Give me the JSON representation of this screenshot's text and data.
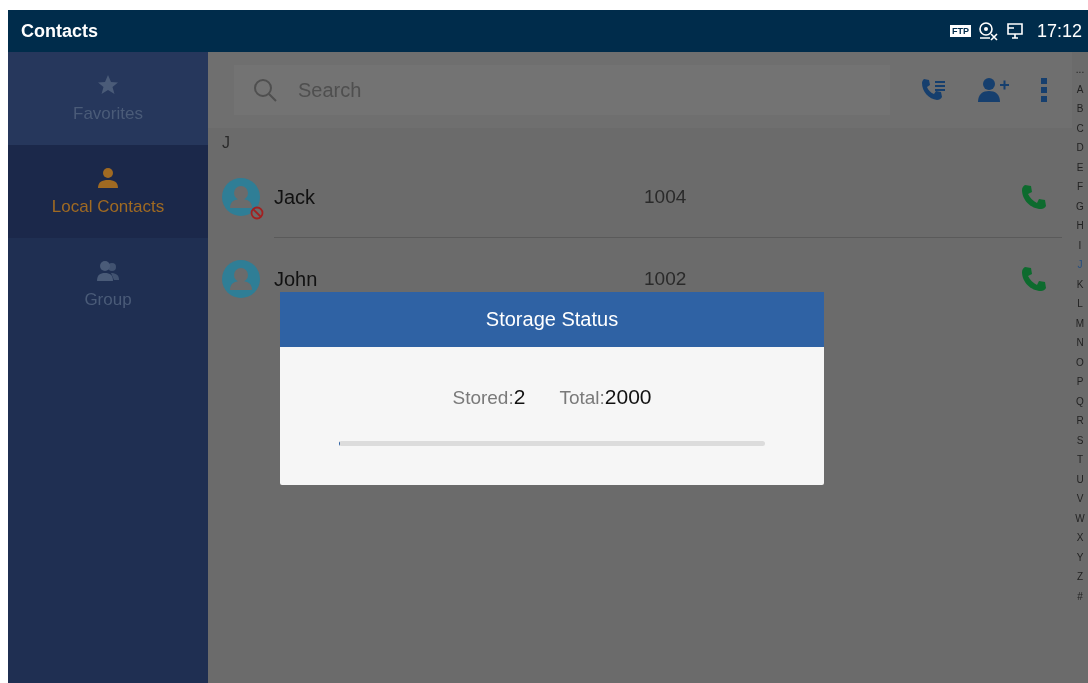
{
  "status_bar": {
    "title": "Contacts",
    "ftp_badge": "FTP",
    "time": "17:12"
  },
  "sidebar": {
    "items": [
      {
        "label": "Favorites",
        "kind": "star",
        "selected": false
      },
      {
        "label": "Local Contacts",
        "kind": "person",
        "selected": true
      },
      {
        "label": "Group",
        "kind": "group",
        "selected": false
      }
    ]
  },
  "search": {
    "placeholder": "Search"
  },
  "section": "J",
  "contacts": [
    {
      "name": "Jack",
      "number": "1004",
      "blocked": true
    },
    {
      "name": "John",
      "number": "1002",
      "blocked": false
    }
  ],
  "index_bar": [
    {
      "label": "...",
      "selected": false
    },
    {
      "label": "A",
      "selected": false
    },
    {
      "label": "B",
      "selected": false
    },
    {
      "label": "C",
      "selected": false
    },
    {
      "label": "D",
      "selected": false
    },
    {
      "label": "E",
      "selected": false
    },
    {
      "label": "F",
      "selected": false
    },
    {
      "label": "G",
      "selected": false
    },
    {
      "label": "H",
      "selected": false
    },
    {
      "label": "I",
      "selected": false
    },
    {
      "label": "J",
      "selected": true
    },
    {
      "label": "K",
      "selected": false
    },
    {
      "label": "L",
      "selected": false
    },
    {
      "label": "M",
      "selected": false
    },
    {
      "label": "N",
      "selected": false
    },
    {
      "label": "O",
      "selected": false
    },
    {
      "label": "P",
      "selected": false
    },
    {
      "label": "Q",
      "selected": false
    },
    {
      "label": "R",
      "selected": false
    },
    {
      "label": "S",
      "selected": false
    },
    {
      "label": "T",
      "selected": false
    },
    {
      "label": "U",
      "selected": false
    },
    {
      "label": "V",
      "selected": false
    },
    {
      "label": "W",
      "selected": false
    },
    {
      "label": "X",
      "selected": false
    },
    {
      "label": "Y",
      "selected": false
    },
    {
      "label": "Z",
      "selected": false
    },
    {
      "label": "#",
      "selected": false
    }
  ],
  "dialog": {
    "title": "Storage Status",
    "stored_label": "Stored:",
    "stored_value": "2",
    "total_label": "Total:",
    "total_value": "2000",
    "progress": {
      "level": 0.001
    }
  }
}
